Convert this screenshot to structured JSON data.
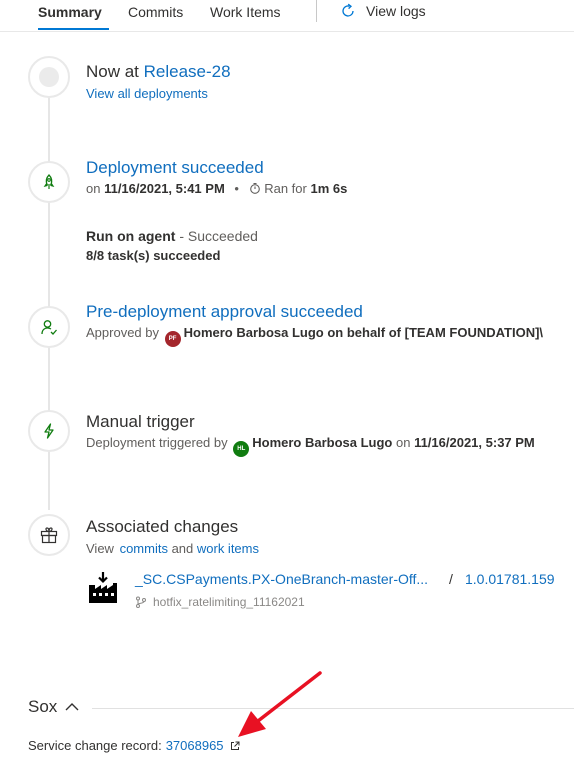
{
  "tabs": {
    "summary": "Summary",
    "commits": "Commits",
    "work_items": "Work Items",
    "view_logs": "View logs"
  },
  "now_at": {
    "prefix": "Now at ",
    "release": "Release-28",
    "view_prefix": "View ",
    "view_link": "all deployments"
  },
  "deployment": {
    "title": "Deployment succeeded",
    "on_prefix": "on ",
    "date": "11/16/2021, 5:41 PM",
    "bullet": "•",
    "ran_for_prefix": "Ran for ",
    "duration": "1m 6s",
    "agent_label": "Run on agent",
    "agent_status": " - Succeeded",
    "tasks": "8/8 task(s) succeeded"
  },
  "approval": {
    "title": "Pre-deployment approval succeeded",
    "approved_by": "Approved by ",
    "avatar_initials": "PF",
    "approver": "Homero Barbosa Lugo on behalf of [TEAM FOUNDATION]\\"
  },
  "trigger": {
    "title": "Manual trigger",
    "triggered_by": "Deployment triggered by ",
    "avatar_initials": "HL",
    "user": "Homero Barbosa Lugo",
    "on_text": " on ",
    "date": "11/16/2021, 5:37 PM"
  },
  "changes": {
    "title": "Associated changes",
    "view": "View ",
    "commits": "commits",
    "and": " and ",
    "work_items": "work items"
  },
  "artifact": {
    "name": "_SC.CSPayments.PX-OneBranch-master-Off...",
    "separator": "/",
    "version": "1.0.01781.159",
    "branch": "hotfix_ratelimiting_11162021"
  },
  "sox": {
    "title": "Sox",
    "service_label": "Service change record:",
    "record_id": "37068965"
  },
  "colors": {
    "accent": "#0078d4",
    "link": "#106ebe",
    "success": "#107c10",
    "avatar_pf": "#a4262c",
    "avatar_hl": "#107c10",
    "arrow": "#e81123"
  },
  "icons": [
    "refresh-arrow-icon",
    "rocket-icon",
    "stopwatch-icon",
    "person-check-icon",
    "lightning-icon",
    "gift-icon",
    "factory-download-icon",
    "branch-icon",
    "chevron-up-icon",
    "external-link-icon"
  ]
}
